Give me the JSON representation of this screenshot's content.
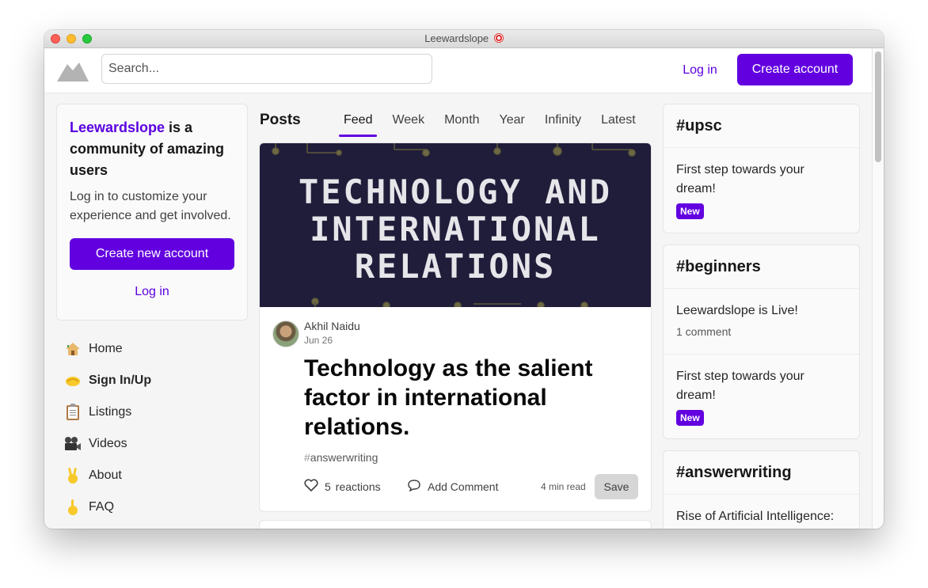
{
  "window": {
    "title": "Leewardslope"
  },
  "header": {
    "search_placeholder": "Search...",
    "login_label": "Log in",
    "create_account_label": "Create account"
  },
  "welcome": {
    "brand": "Leewardslope",
    "headline_rest": " is a community of amazing users",
    "subtext": "Log in to customize your experience and get involved.",
    "cta_label": "Create new account",
    "login_label": "Log in"
  },
  "nav": {
    "items": [
      {
        "label": "Home",
        "icon": "house-icon"
      },
      {
        "label": "Sign In/Up",
        "icon": "handshake-icon"
      },
      {
        "label": "Listings",
        "icon": "clipboard-icon"
      },
      {
        "label": "Videos",
        "icon": "movie-camera-icon"
      },
      {
        "label": "About",
        "icon": "victory-hand-icon"
      },
      {
        "label": "FAQ",
        "icon": "pointing-up-icon"
      }
    ]
  },
  "feed": {
    "title": "Posts",
    "tabs": [
      "Feed",
      "Week",
      "Month",
      "Year",
      "Infinity",
      "Latest"
    ],
    "active_tab": "Feed"
  },
  "post": {
    "cover_text": "TECHNOLOGY AND INTERNATIONAL RELATIONS",
    "author": "Akhil Naidu",
    "date": "Jun 26",
    "title": "Technology as the salient factor in international relations.",
    "tag_hash": "#",
    "tag": "answerwriting",
    "reaction_count": "5",
    "reactions_label": "reactions",
    "comment_label": "Add Comment",
    "read_time": "4 min read",
    "save_label": "Save"
  },
  "sidebar_right": {
    "cards": [
      {
        "heading": "#upsc",
        "items": [
          {
            "title": "First step towards your dream!",
            "badge": "New"
          }
        ]
      },
      {
        "heading": "#beginners",
        "items": [
          {
            "title": "Leewardslope is Live!",
            "meta": "1 comment"
          },
          {
            "title": "First step towards your dream!",
            "badge": "New"
          }
        ]
      },
      {
        "heading": "#answerwriting",
        "items": [
          {
            "title": "Rise of Artificial Intelligence:"
          }
        ]
      }
    ]
  },
  "colors": {
    "accent": "#6200e0",
    "accent_text": "#5b00e0",
    "cover_bg": "#201d3a"
  }
}
